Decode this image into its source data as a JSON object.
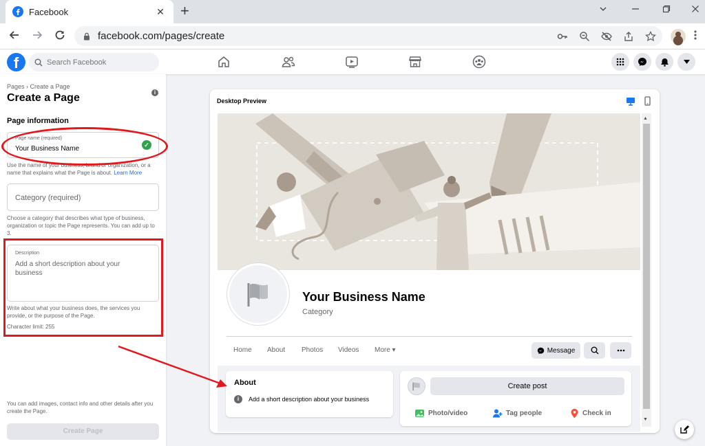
{
  "browser": {
    "tab_title": "Facebook",
    "tab_close": "✕",
    "new_tab": "+",
    "url": "facebook.com/pages/create"
  },
  "fb": {
    "logo": "f",
    "search_placeholder": "Search Facebook"
  },
  "left": {
    "breadcrumb": "Pages › Create a Page",
    "title": "Create a Page",
    "section_title": "Page information",
    "page_name_label": "Page name (required)",
    "page_name_value": "Your Business Name",
    "page_name_helper": "Use the name of your business, brand or organization, or a name that explains what the Page is about.",
    "learn_more": "Learn More",
    "category_placeholder": "Category (required)",
    "category_helper": "Choose a category that describes what type of business, organization or topic the Page represents. You can add up to 3.",
    "description_label": "Description",
    "description_placeholder": "Add a short description about your business",
    "description_helper": "Write about what your business does, the services you provide, or the purpose of the Page.",
    "char_limit": "Character limit: 255",
    "bottom_note": "You can add images, contact info and other details after you create the Page.",
    "create_button": "Create Page"
  },
  "preview": {
    "title": "Desktop Preview",
    "business_name": "Your Business Name",
    "category": "Category",
    "tabs": [
      "Home",
      "About",
      "Photos",
      "Videos",
      "More ▾"
    ],
    "message_button": "Message",
    "about_title": "About",
    "about_text": "Add a short description about your business",
    "create_post": "Create post",
    "photo_video": "Photo/video",
    "tag_people": "Tag people",
    "check_in": "Check in"
  },
  "colors": {
    "fb_blue": "#1877f2",
    "annotation_red": "#e0191d",
    "success_green": "#31a24c"
  }
}
